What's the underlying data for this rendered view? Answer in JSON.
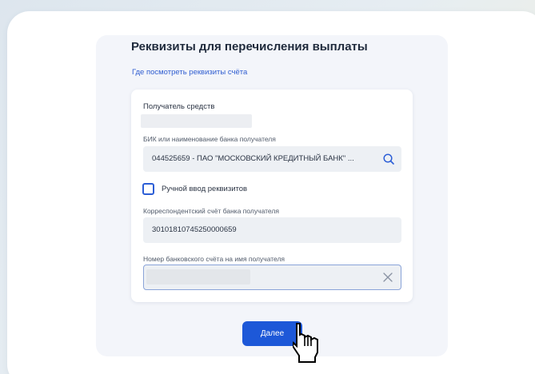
{
  "page": {
    "title": "Реквизиты для перечисления выплаты",
    "details_link": "Где посмотреть реквизиты счёта"
  },
  "form": {
    "recipient": {
      "label": "Получатель средств",
      "value": ""
    },
    "bank": {
      "label": "БИК или наименование банка получателя",
      "value": "044525659 - ПАО \"МОСКОВСКИЙ КРЕДИТНЫЙ БАНК\" ...",
      "icon": "search-icon"
    },
    "manual_entry": {
      "label": "Ручной ввод реквизитов",
      "checked": false
    },
    "corr_account": {
      "label": "Корреспондентский счёт банка получателя",
      "value": "30101810745250000659"
    },
    "account_number": {
      "label": "Номер банковского счёта на имя получателя",
      "value": "",
      "icon": "close-icon"
    }
  },
  "actions": {
    "next_label": "Далее"
  },
  "colors": {
    "accent": "#1d58d8",
    "link": "#2f5dd0",
    "field_bg": "#edf0f4"
  }
}
